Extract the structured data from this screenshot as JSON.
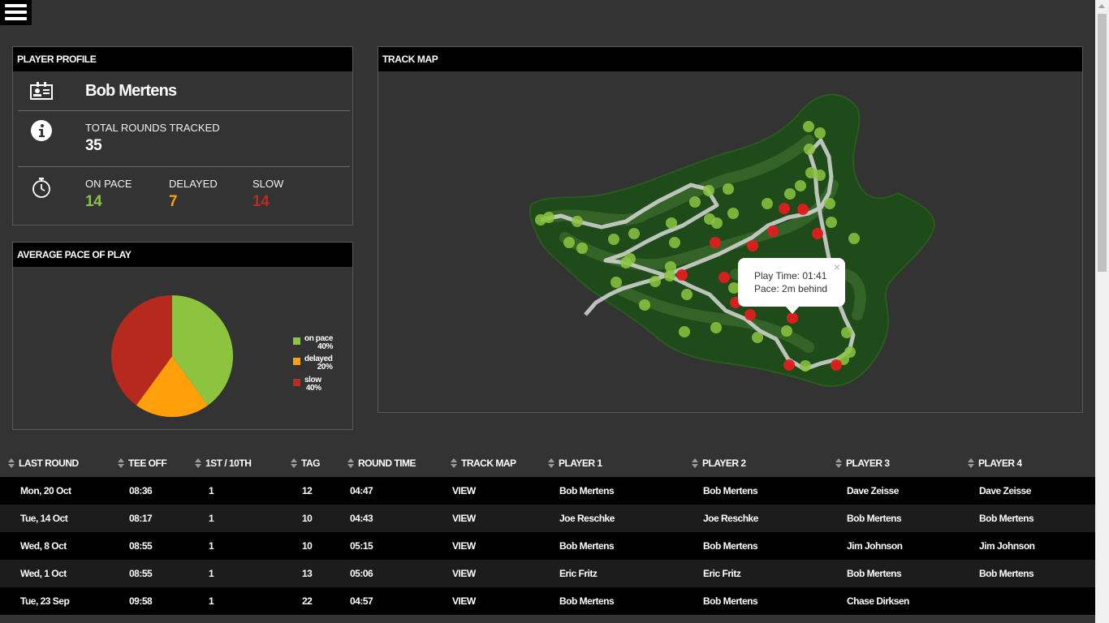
{
  "profile": {
    "title": "PLAYER PROFILE",
    "name": "Bob Mertens",
    "rounds_label": "TOTAL ROUNDS TRACKED",
    "rounds_value": "35",
    "on_pace_label": "ON PACE",
    "on_pace_value": "14",
    "delayed_label": "DELAYED",
    "delayed_value": "7",
    "slow_label": "SLOW",
    "slow_value": "14",
    "colors": {
      "on_pace": "#8cc43f",
      "delayed": "#ff9f0a",
      "slow": "#c0291e"
    }
  },
  "pace": {
    "title": "AVERAGE PACE OF PLAY",
    "legend": [
      {
        "name": "on pace",
        "pct": "40%",
        "color": "#8cc43f"
      },
      {
        "name": "delayed",
        "pct": "20%",
        "color": "#ff9f0a"
      },
      {
        "name": "slow",
        "pct": "40%",
        "color": "#c0291e"
      }
    ]
  },
  "chart_data": {
    "type": "pie",
    "categories": [
      "on pace",
      "delayed",
      "slow"
    ],
    "values": [
      40,
      20,
      40
    ],
    "colors": [
      "#8cc43f",
      "#ff9f0a",
      "#b52a1c"
    ],
    "title": "AVERAGE PACE OF PLAY",
    "legend": "right"
  },
  "trackmap": {
    "title": "TRACK MAP",
    "popup": {
      "play_time": "Play Time: 01:41",
      "pace": "Pace: 2m behind",
      "close": "×"
    },
    "marker_colors": {
      "on_pace": "#8cc43f",
      "slow": "#e01e1e"
    }
  },
  "table": {
    "headers": [
      "LAST ROUND",
      "TEE OFF",
      "1ST / 10TH",
      "TAG",
      "ROUND TIME",
      "TRACK MAP",
      "PLAYER 1",
      "PLAYER 2",
      "PLAYER 3",
      "PLAYER 4"
    ],
    "rows": [
      [
        "Mon, 20 Oct",
        "08:36",
        "1",
        "12",
        "04:47",
        "VIEW",
        "Bob Mertens",
        "Bob Mertens",
        "Dave Zeisse",
        "Dave Zeisse"
      ],
      [
        "Tue, 14 Oct",
        "08:17",
        "1",
        "10",
        "04:43",
        "VIEW",
        "Joe Reschke",
        "Joe Reschke",
        "Bob Mertens",
        "Bob Mertens"
      ],
      [
        "Wed, 8 Oct",
        "08:55",
        "1",
        "10",
        "05:15",
        "VIEW",
        "Bob Mertens",
        "Bob Mertens",
        "Jim Johnson",
        "Jim Johnson"
      ],
      [
        "Wed, 1 Oct",
        "08:55",
        "1",
        "13",
        "05:06",
        "VIEW",
        "Eric Fritz",
        "Eric Fritz",
        "Bob Mertens",
        "Bob Mertens"
      ],
      [
        "Tue, 23 Sep",
        "09:58",
        "1",
        "22",
        "04:57",
        "VIEW",
        "Bob Mertens",
        "Bob Mertens",
        "Chase Dirksen",
        ""
      ]
    ]
  }
}
